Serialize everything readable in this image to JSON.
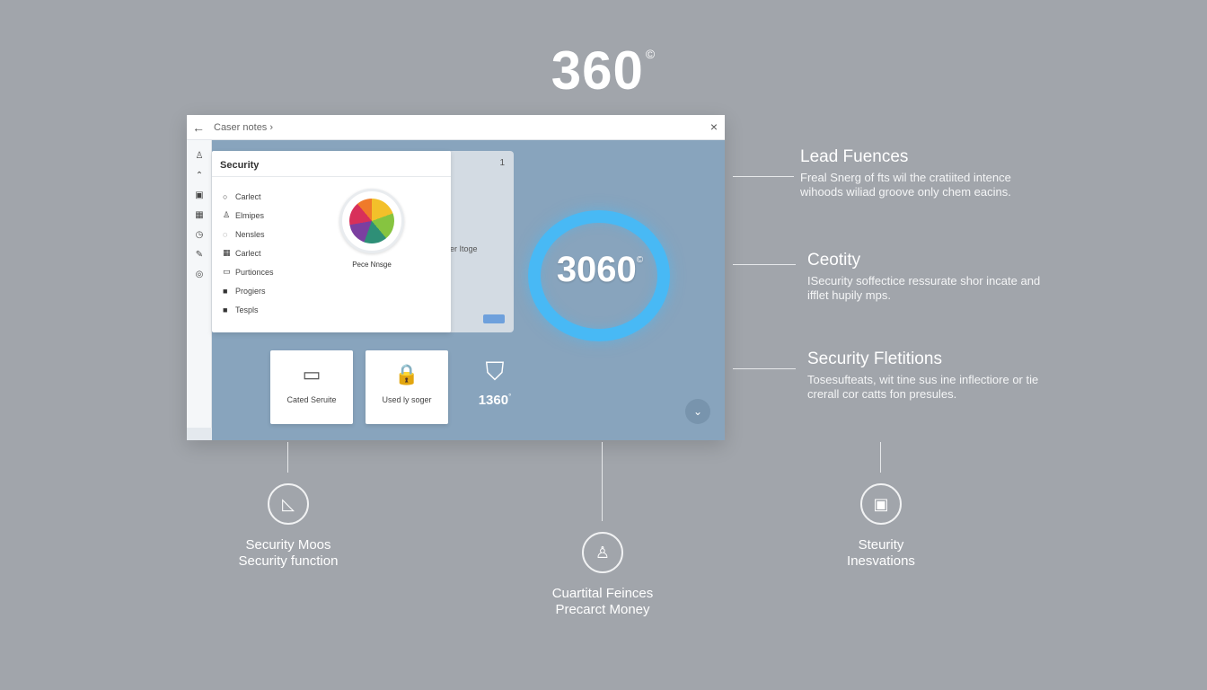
{
  "hero": {
    "title": "360",
    "mark": "©"
  },
  "window": {
    "back_icon": "←",
    "breadcrumb": "Caser notes ›",
    "close_icon": "×",
    "rail_icons": [
      "♙",
      "⌃",
      "▣",
      "▦",
      "◷",
      "✎",
      "◎"
    ],
    "menu": {
      "title": "Security",
      "items": [
        {
          "icon": "○",
          "label": "Carlect"
        },
        {
          "icon": "♙",
          "label": "Elmipes"
        },
        {
          "icon": "◌",
          "label": "Nensles"
        },
        {
          "icon": "▦",
          "label": "Carlect"
        },
        {
          "icon": "▭",
          "label": "Purtionces"
        },
        {
          "icon": "■",
          "label": "Progiers"
        },
        {
          "icon": "■",
          "label": "Tespls"
        }
      ],
      "logo_caption": "Pece Nnsge"
    },
    "back_panel": {
      "number": "1",
      "label": "ider Itoge"
    },
    "gauge": {
      "value": "3060",
      "mark": "©"
    },
    "tiles": [
      {
        "icon": "▭",
        "label": "Cated Seruite"
      },
      {
        "icon": "🔒",
        "label": "Used ly soger"
      }
    ],
    "shield": {
      "icon": "⛉",
      "label": "1360",
      "mark": "°"
    },
    "scroll_icon": "⌄"
  },
  "notes": [
    {
      "title": "Lead Fuences",
      "desc": "Freal Snerg of fts wil the cratiited intence wihoods wiliad groove only chem eacins."
    },
    {
      "title": "Ceotity",
      "desc": "ISecurity soffectice ressurate shor incate and ifflet hupily mps."
    },
    {
      "title": "Security Fletitions",
      "desc": "Tosesufteats, wit tine sus ine inflectiore or tie crerall cor catts fon presules."
    }
  ],
  "features": [
    {
      "icon": "◺",
      "label_line1": "Security Moos",
      "label_line2": "Security function"
    },
    {
      "icon": "♙",
      "label_line1": "Cuartital Feinces",
      "label_line2": "Precarct Money"
    },
    {
      "icon": "▣",
      "label_line1": "Steurity",
      "label_line2": "Inesvations"
    }
  ]
}
